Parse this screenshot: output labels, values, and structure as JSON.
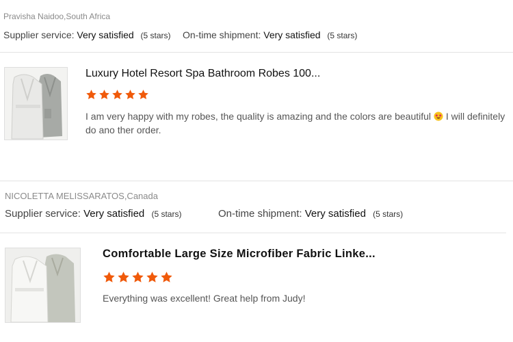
{
  "reviews": [
    {
      "reviewer": "Pravisha Naidoo,South Africa",
      "supplier_label": "Supplier service:",
      "supplier_value": "Very satisfied",
      "supplier_stars": "(5 stars)",
      "shipment_label": "On-time shipment:",
      "shipment_value": "Very satisfied",
      "shipment_stars": "(5 stars)",
      "product_title": "Luxury Hotel Resort Spa Bathroom Robes 100...",
      "rating": 5,
      "comment_before": "I am very happy with my robes, the quality is amazing and the colors are beautiful",
      "emoji": "star-struck-emoji",
      "comment_after": " I will definitely do ano ther order."
    },
    {
      "reviewer": "NICOLETTA MELISSARATOS,Canada",
      "supplier_label": "Supplier service:",
      "supplier_value": "Very satisfied",
      "supplier_stars": "(5 stars)",
      "shipment_label": "On-time shipment:",
      "shipment_value": "Very satisfied",
      "shipment_stars": "(5 stars)",
      "product_title": "Comfortable Large Size Microfiber Fabric Linke...",
      "rating": 5,
      "comment": "Everything was excellent! Great help from Judy!"
    }
  ],
  "colors": {
    "star": "#f05a0a",
    "divider": "#e3e3e3"
  }
}
